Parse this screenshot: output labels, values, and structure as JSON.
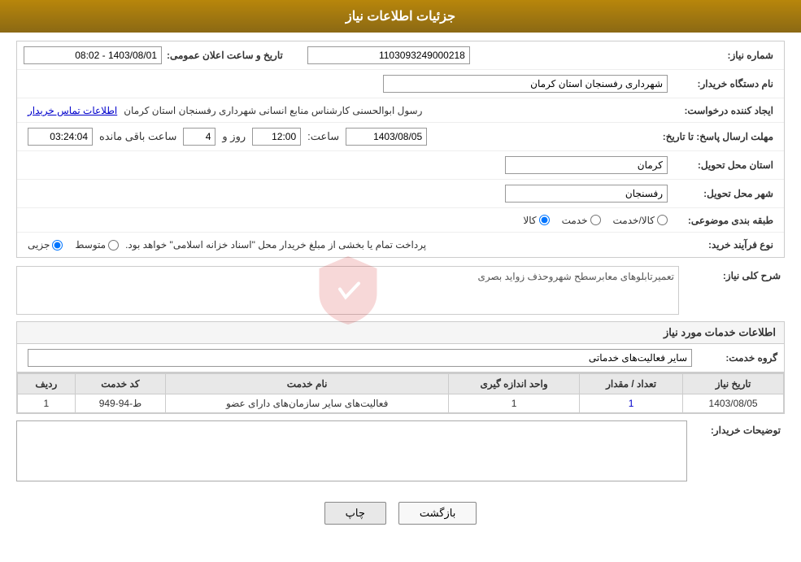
{
  "page": {
    "title": "جزئیات اطلاعات نیاز"
  },
  "header": {
    "title": "جزئیات اطلاعات نیاز"
  },
  "fields": {
    "need_number_label": "شماره نیاز:",
    "need_number_value": "1103093249000218",
    "buyer_org_label": "نام دستگاه خریدار:",
    "buyer_org_value": "شهرداری رفسنجان استان کرمان",
    "announcement_date_label": "تاریخ و ساعت اعلان عمومی:",
    "announcement_date_value": "1403/08/01 - 08:02",
    "creator_label": "ایجاد کننده درخواست:",
    "creator_value": "رسول ابوالحسنی کارشناس منابع انسانی شهرداری رفسنجان استان کرمان",
    "contact_link": "اطلاعات تماس خریدار",
    "reply_deadline_label": "مهلت ارسال پاسخ: تا تاریخ:",
    "reply_date_value": "1403/08/05",
    "reply_time_label": "ساعت:",
    "reply_time_value": "12:00",
    "reply_days_label": "روز و",
    "reply_days_value": "4",
    "remaining_time_label": "ساعت باقی مانده",
    "remaining_time_value": "03:24:04",
    "delivery_province_label": "استان محل تحویل:",
    "delivery_province_value": "کرمان",
    "delivery_city_label": "شهر محل تحویل:",
    "delivery_city_value": "رفسنجان",
    "category_label": "طبقه بندی موضوعی:",
    "category_options": [
      {
        "label": "کالا",
        "value": "kala",
        "selected": false
      },
      {
        "label": "خدمت",
        "value": "khedmat",
        "selected": false
      },
      {
        "label": "کالا/خدمت",
        "value": "kala_khedmat",
        "selected": false
      }
    ],
    "purchase_type_label": "نوع فرآیند خرید:",
    "purchase_type_options": [
      {
        "label": "جزیی",
        "value": "jozi",
        "selected": false
      },
      {
        "label": "متوسط",
        "value": "motavasset",
        "selected": false
      }
    ],
    "purchase_type_note": "پرداخت تمام یا بخشی از مبلغ خریدار محل \"اسناد خزانه اسلامی\" خواهد بود.",
    "need_description_label": "شرح کلی نیاز:",
    "need_description_value": "تعمیرتابلوهای معابرسطح شهروحذف زواید بصری"
  },
  "services_section": {
    "title": "اطلاعات خدمات مورد نیاز",
    "group_label": "گروه خدمت:",
    "group_value": "سایر فعالیت‌های خدماتی",
    "table_headers": {
      "row_num": "ردیف",
      "service_code": "کد خدمت",
      "service_name": "نام خدمت",
      "unit": "واحد اندازه گیری",
      "quantity": "تعداد / مقدار",
      "need_date": "تاریخ نیاز"
    },
    "table_rows": [
      {
        "row_num": "1",
        "service_code": "ط-94-949",
        "service_name": "فعالیت‌های سایر سازمان‌های دارای عضو",
        "unit": "1",
        "quantity": "1",
        "need_date": "1403/08/05"
      }
    ]
  },
  "buyer_notes": {
    "label": "توضیحات خریدار:",
    "value": ""
  },
  "buttons": {
    "print_label": "چاپ",
    "back_label": "بازگشت"
  }
}
